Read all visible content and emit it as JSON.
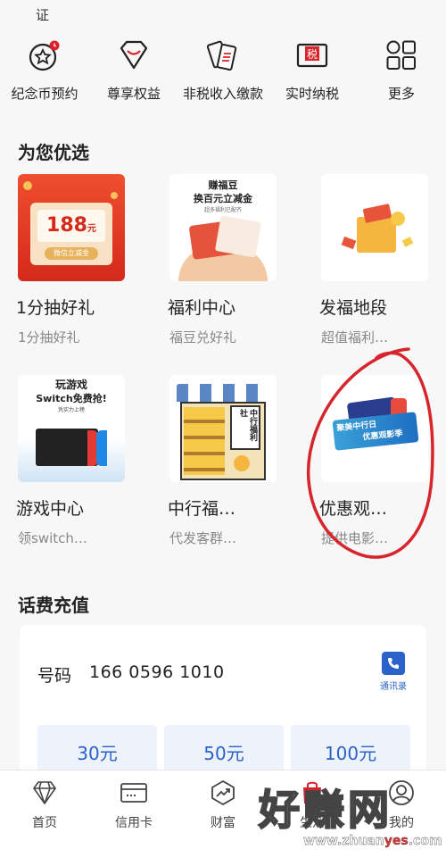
{
  "header": {
    "cut_text": "证"
  },
  "quick_menu": [
    {
      "label": "纪念币预约",
      "icon": "commemorative-coin-icon"
    },
    {
      "label": "尊享权益",
      "icon": "diamond-icon"
    },
    {
      "label": "非税收入缴款",
      "icon": "non-tax-payment-icon"
    },
    {
      "label": "实时纳税",
      "icon": "tax-icon",
      "icon_text": "税"
    },
    {
      "label": "更多",
      "icon": "more-grid-icon"
    }
  ],
  "recommend": {
    "title": "为您优选",
    "items": [
      {
        "title": "1分抽好礼",
        "subtitle": "1分抽好礼",
        "thumb": {
          "big": "188",
          "unit": "元",
          "tag": "微信立减金"
        }
      },
      {
        "title": "福利中心",
        "subtitle": "福豆兑好礼",
        "thumb": {
          "line1": "赚福豆",
          "line2": "换百元立减金",
          "line3": "超多福利已配齐"
        }
      },
      {
        "title": "发福地段",
        "subtitle": "超值福利…"
      },
      {
        "title": "游戏中心",
        "subtitle": "领switch…",
        "thumb": {
          "line1": "玩游戏",
          "line2": "Switch免费抢!",
          "line3": "凭实力上榜"
        }
      },
      {
        "title": "中行福…",
        "subtitle": "代发客群…",
        "thumb": {
          "sign": "中行福利社"
        }
      },
      {
        "title": "优惠观…",
        "subtitle": "提供电影…",
        "thumb": {
          "line1": "聚美中行日",
          "line2": "优惠观影季"
        }
      }
    ]
  },
  "recharge": {
    "title": "话费充值",
    "phone_label": "号码",
    "phone_number": "166 0596 1010",
    "contacts_label": "通讯录",
    "amounts": [
      "30元",
      "50元",
      "100元"
    ]
  },
  "tabbar": [
    {
      "label": "首页",
      "icon": "home-diamond-icon"
    },
    {
      "label": "信用卡",
      "icon": "credit-card-icon"
    },
    {
      "label": "财富",
      "icon": "wealth-chart-icon"
    },
    {
      "label": "生活",
      "icon": "life-bag-icon"
    },
    {
      "label": "我的",
      "icon": "user-profile-icon"
    }
  ],
  "watermark": {
    "big": "好赚网",
    "small_a": "www.zhuan",
    "small_red": "yes",
    "small_b": ".com"
  },
  "colors": {
    "accent_red": "#d8232a",
    "blue": "#2a62c9",
    "annotation_red": "#d6252c"
  }
}
